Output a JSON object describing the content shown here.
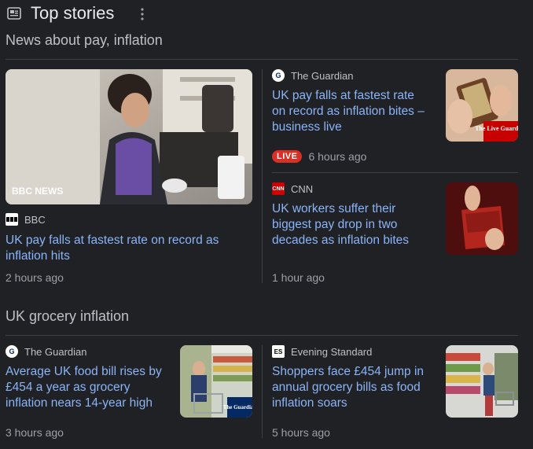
{
  "header": {
    "title": "Top stories",
    "icon": "newspaper-icon",
    "more_icon": "more-vert-icon"
  },
  "sections": [
    {
      "title": "News about pay, inflation",
      "stories": [
        {
          "source": "BBC",
          "headline": "UK pay falls at fastest rate on record as inflation hits",
          "time": "2 hours ago",
          "image_caption": "BBC NEWS"
        },
        {
          "source": "The Guardian",
          "headline": "UK pay falls at fastest rate on record as inflation bites – business live",
          "time": "6 hours ago",
          "live_badge": "LIVE",
          "image_caption": "The Live Guardian"
        },
        {
          "source": "CNN",
          "headline": "UK workers suffer their biggest pay drop in two decades as inflation bites",
          "time": "1 hour ago",
          "logo_text": "CNN"
        }
      ]
    },
    {
      "title": "UK grocery inflation",
      "stories": [
        {
          "source": "The Guardian",
          "headline": "Average UK food bill rises by £454 a year as grocery inflation nears 14-year high",
          "time": "3 hours ago",
          "image_caption": "The Guardian"
        },
        {
          "source": "Evening Standard",
          "headline": "Shoppers face £454 jump in annual grocery bills as food inflation soars",
          "time": "5 hours ago",
          "logo_text": "ES"
        }
      ]
    }
  ],
  "colors": {
    "background": "#202124",
    "link": "#8ab4f8",
    "live": "#d93025"
  }
}
